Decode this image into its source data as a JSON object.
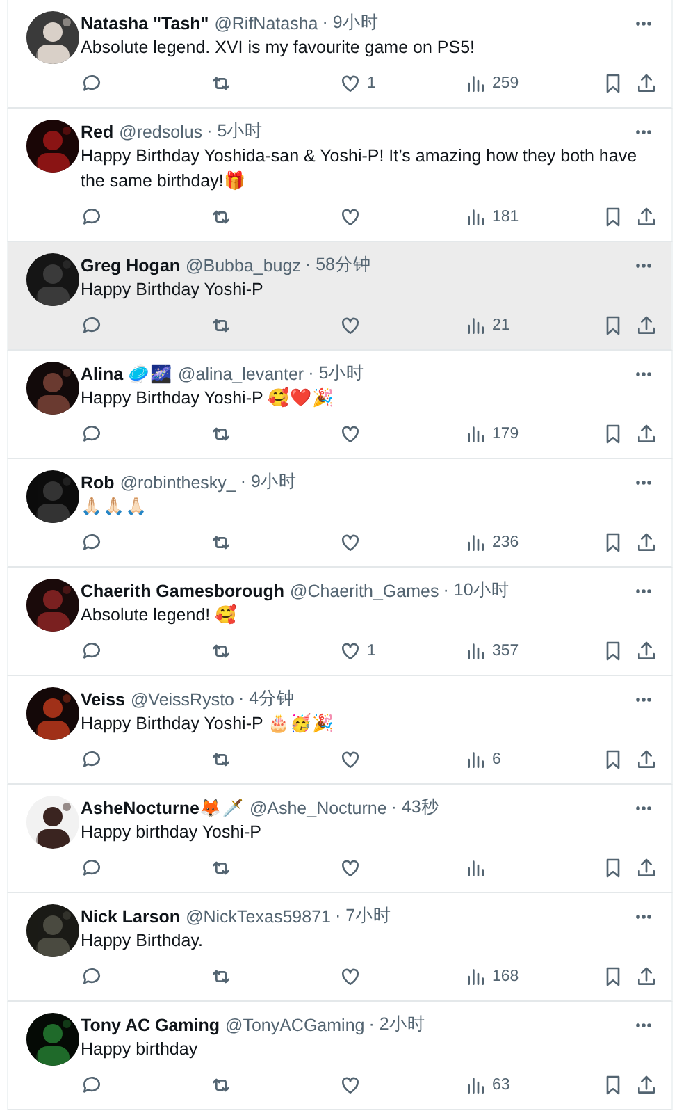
{
  "replies": [
    {
      "name": "Natasha \"Tash\"",
      "handle": "@RifNatasha",
      "time": "· 9小时",
      "text": "Absolute legend. XVI is my favourite game on PS5!",
      "likes": "1",
      "views": "259",
      "highlighted": false
    },
    {
      "name": "Red",
      "handle": "@redsolus",
      "time": "· 5小时",
      "text": "Happy Birthday Yoshida-san & Yoshi-P! It’s amazing how they both have the same birthday!🎁",
      "views": "181",
      "highlighted": false
    },
    {
      "name": "Greg Hogan",
      "handle": "@Bubba_bugz",
      "time": "· 58分钟",
      "text": "Happy Birthday Yoshi-P",
      "views": "21",
      "highlighted": true
    },
    {
      "name": "Alina 🥏🌌",
      "handle": "@alina_levanter",
      "time": "· 5小时",
      "text": "Happy Birthday Yoshi-P 🥰❤️🎉",
      "views": "179",
      "highlighted": false
    },
    {
      "name": "Rob",
      "handle": "@robinthesky_",
      "time": "· 9小时",
      "text": "🙏🏻🙏🏻🙏🏻",
      "views": "236",
      "highlighted": false
    },
    {
      "name": "Chaerith Gamesborough",
      "handle": "@Chaerith_Games",
      "time": "· 10小时",
      "text": "Absolute legend! 🥰",
      "likes": "1",
      "views": "357",
      "highlighted": false
    },
    {
      "name": "Veiss",
      "handle": "@VeissRysto",
      "time": "· 4分钟",
      "text": "Happy Birthday Yoshi-P 🎂🥳🎉",
      "views": "6",
      "highlighted": false
    },
    {
      "name": "AsheNocturne🦊🗡️",
      "handle": "@Ashe_Nocturne",
      "time": "· 43秒",
      "text": "Happy birthday Yoshi-P",
      "highlighted": false
    },
    {
      "name": "Nick Larson",
      "handle": "@NickTexas59871",
      "time": "· 7小时",
      "text": "Happy Birthday.",
      "views": "168",
      "highlighted": false
    },
    {
      "name": "Tony AC Gaming",
      "handle": "@TonyACGaming",
      "time": "· 2小时",
      "text": "Happy birthday",
      "views": "63",
      "highlighted": false
    }
  ]
}
